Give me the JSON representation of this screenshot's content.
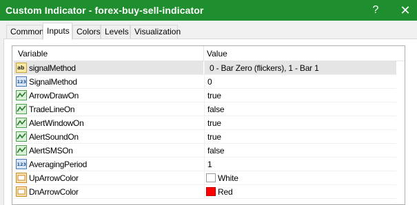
{
  "window": {
    "title": "Custom Indicator - forex-buy-sell-indicator",
    "help_label": "?",
    "close_label": "✕",
    "titlebar_color": "#1e8e2e"
  },
  "tabs": [
    {
      "label": "Common",
      "active": false
    },
    {
      "label": "Inputs",
      "active": true
    },
    {
      "label": "Colors",
      "active": false
    },
    {
      "label": "Levels",
      "active": false
    },
    {
      "label": "Visualization",
      "active": false
    }
  ],
  "grid": {
    "columns": {
      "variable": "Variable",
      "value": "Value"
    },
    "rows": [
      {
        "icon": "string-icon",
        "name": "signalMethod",
        "value": "0 - Bar Zero (flickers), 1 - Bar 1",
        "selected": true
      },
      {
        "icon": "integer-icon",
        "name": "SignalMethod",
        "value": "0"
      },
      {
        "icon": "boolean-icon",
        "name": "ArrowDrawOn",
        "value": "true"
      },
      {
        "icon": "boolean-icon",
        "name": "TradeLineOn",
        "value": "false"
      },
      {
        "icon": "boolean-icon",
        "name": "AlertWindowOn",
        "value": "true"
      },
      {
        "icon": "boolean-icon",
        "name": "AlertSoundOn",
        "value": "true"
      },
      {
        "icon": "boolean-icon",
        "name": "AlertSMSOn",
        "value": "false"
      },
      {
        "icon": "integer-icon",
        "name": "AveragingPeriod",
        "value": "1"
      },
      {
        "icon": "color-icon",
        "name": "UpArrowColor",
        "value": "White",
        "swatch": "#ffffff"
      },
      {
        "icon": "color-icon",
        "name": "DnArrowColor",
        "value": "Red",
        "swatch": "#ff0000"
      }
    ]
  },
  "scrollbar": {
    "up_glyph": "▲",
    "down_glyph": "▼",
    "position": 0.0
  }
}
